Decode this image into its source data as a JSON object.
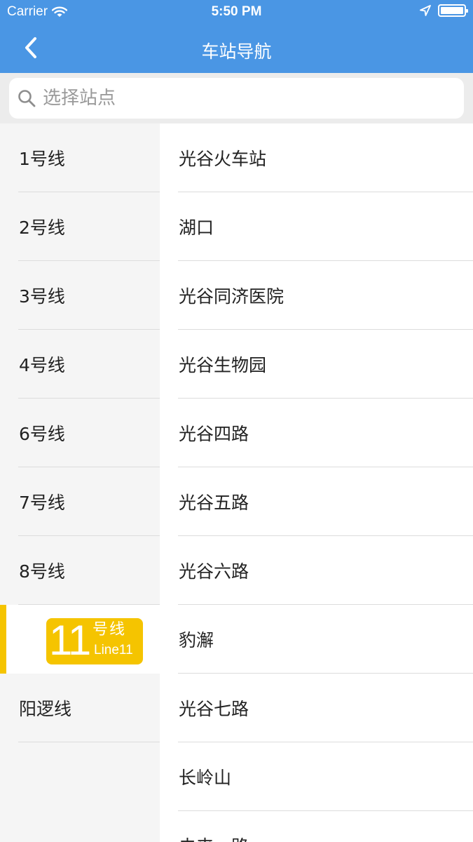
{
  "status_bar": {
    "carrier": "Carrier",
    "time": "5:50 PM",
    "icons": [
      "wifi-icon",
      "location-arrow-icon",
      "battery-icon"
    ]
  },
  "nav": {
    "title": "车站导航",
    "back_icon": "chevron-left-icon"
  },
  "search": {
    "placeholder": "选择站点",
    "value": "",
    "icon": "search-icon"
  },
  "lines": [
    {
      "label": "1号线"
    },
    {
      "label": "2号线"
    },
    {
      "label": "3号线"
    },
    {
      "label": "4号线"
    },
    {
      "label": "6号线"
    },
    {
      "label": "7号线"
    },
    {
      "label": "8号线"
    }
  ],
  "selected_line": {
    "number": "11",
    "cn": "号线",
    "en": "Line11"
  },
  "lines_after": [
    {
      "label": "阳逻线"
    }
  ],
  "stations": [
    {
      "label": "光谷火车站"
    },
    {
      "label": "湖口"
    },
    {
      "label": "光谷同济医院"
    },
    {
      "label": "光谷生物园"
    },
    {
      "label": "光谷四路"
    },
    {
      "label": "光谷五路"
    },
    {
      "label": "光谷六路"
    },
    {
      "label": "豹澥"
    },
    {
      "label": "光谷七路"
    },
    {
      "label": "长岭山"
    },
    {
      "label": "未来一路"
    }
  ],
  "colors": {
    "header": "#4a96e4",
    "accent": "#f5c400",
    "sidebar_bg": "#f5f5f5"
  }
}
